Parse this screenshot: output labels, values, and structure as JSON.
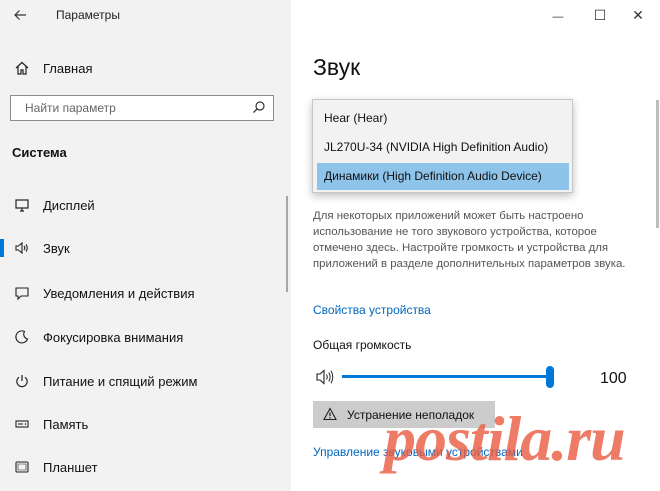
{
  "window": {
    "title": "Параметры",
    "back_icon": "back-arrow-icon",
    "minimize_glyph": "—",
    "maximize_glyph": "☐",
    "close_glyph": "✕"
  },
  "sidebar": {
    "home_label": "Главная",
    "search_placeholder": "Найти параметр",
    "section_title": "Система",
    "items": [
      {
        "label": "Дисплей",
        "icon": "display-icon",
        "active": false
      },
      {
        "label": "Звук",
        "icon": "sound-icon",
        "active": true
      },
      {
        "label": "Уведомления и действия",
        "icon": "notifications-icon",
        "active": false
      },
      {
        "label": "Фокусировка внимания",
        "icon": "focus-assist-icon",
        "active": false
      },
      {
        "label": "Питание и спящий режим",
        "icon": "power-icon",
        "active": false
      },
      {
        "label": "Память",
        "icon": "storage-icon",
        "active": false
      },
      {
        "label": "Планшет",
        "icon": "tablet-icon",
        "active": false
      }
    ]
  },
  "main": {
    "title": "Звук",
    "output_dropdown": {
      "options": [
        "Hear (Hear)",
        "JL270U-34 (NVIDIA High Definition Audio)",
        "Динамики (High Definition Audio Device)"
      ],
      "selected_index": 2
    },
    "description": "Для некоторых приложений может быть настроено использование не того звукового устройства, которое отмечено здесь. Настройте громкость и устройства для приложений в разделе дополнительных параметров звука.",
    "device_properties_link": "Свойства устройства",
    "volume_label": "Общая громкость",
    "volume_value": "100",
    "volume_level": 100,
    "troubleshoot_button": "Устранение неполадок",
    "manage_devices_link": "Управление звуковыми устройствами"
  },
  "watermark": "postila.ru",
  "colors": {
    "accent": "#0078d7",
    "link": "#0067c0",
    "selection": "#8ec3ea",
    "sidebar_bg": "#f2f2f2",
    "watermark": "#e85a40"
  }
}
